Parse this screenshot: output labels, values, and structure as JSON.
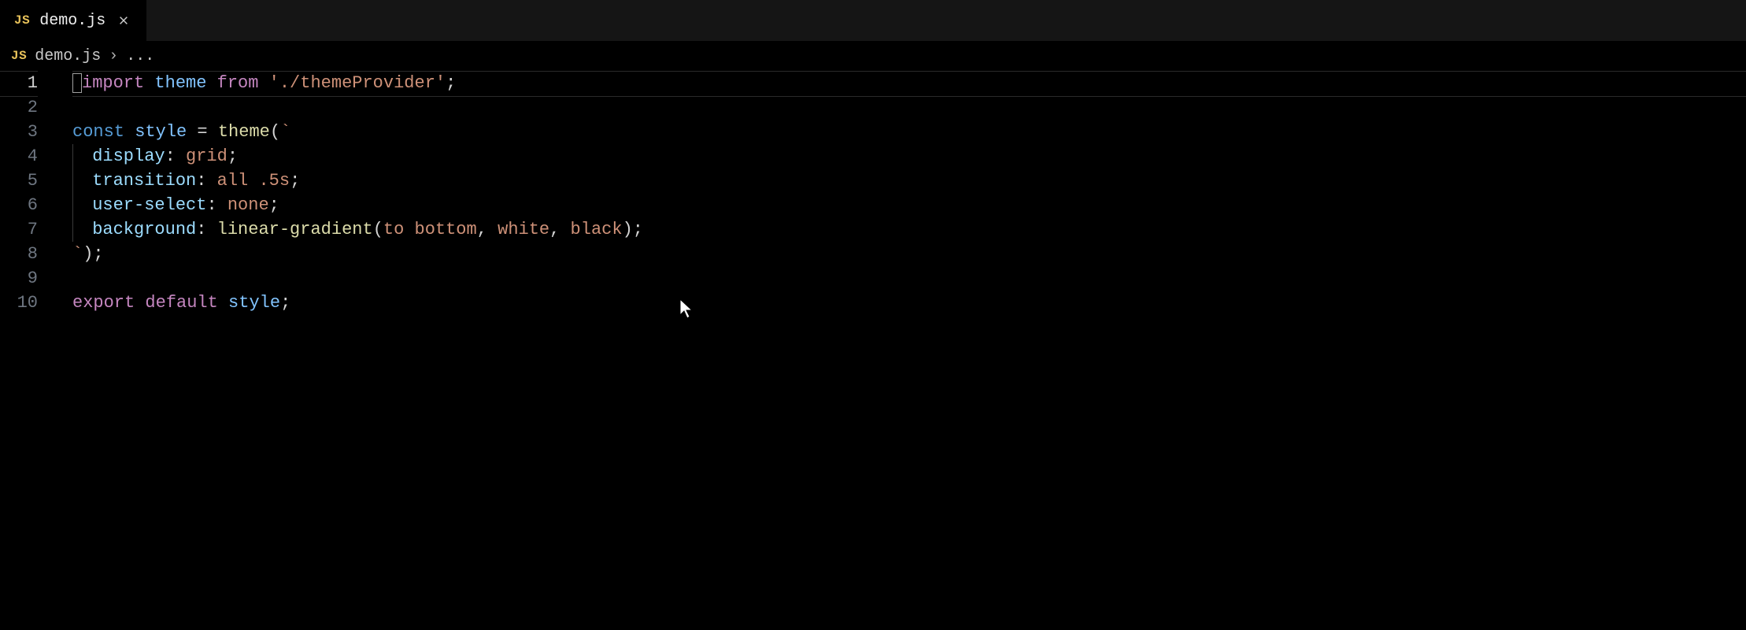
{
  "tab": {
    "badge": "JS",
    "filename": "demo.js"
  },
  "breadcrumb": {
    "badge": "JS",
    "filename": "demo.js",
    "chevron": "›",
    "extra": "..."
  },
  "lines": [
    {
      "n": "1",
      "tokens": [
        {
          "t": "import ",
          "c": "tk-keyword"
        },
        {
          "t": "theme",
          "c": "tk-var2"
        },
        {
          "t": " from ",
          "c": "tk-keyword"
        },
        {
          "t": "'./themeProvider'",
          "c": "tk-string"
        },
        {
          "t": ";",
          "c": "tk-plain"
        }
      ],
      "current": true
    },
    {
      "n": "2",
      "tokens": []
    },
    {
      "n": "3",
      "tokens": [
        {
          "t": "const ",
          "c": "tk-const"
        },
        {
          "t": "style",
          "c": "tk-var2"
        },
        {
          "t": " = ",
          "c": "tk-plain"
        },
        {
          "t": "theme",
          "c": "tk-func"
        },
        {
          "t": "(",
          "c": "tk-plain"
        },
        {
          "t": "`",
          "c": "tk-string"
        }
      ]
    },
    {
      "n": "4",
      "indent": true,
      "tokens": [
        {
          "t": " display",
          "c": "tk-prop"
        },
        {
          "t": ": ",
          "c": "tk-plain"
        },
        {
          "t": "grid",
          "c": "tk-string"
        },
        {
          "t": ";",
          "c": "tk-plain"
        }
      ]
    },
    {
      "n": "5",
      "indent": true,
      "tokens": [
        {
          "t": " transition",
          "c": "tk-prop"
        },
        {
          "t": ": ",
          "c": "tk-plain"
        },
        {
          "t": "all .5s",
          "c": "tk-string"
        },
        {
          "t": ";",
          "c": "tk-plain"
        }
      ]
    },
    {
      "n": "6",
      "indent": true,
      "tokens": [
        {
          "t": " user-select",
          "c": "tk-prop"
        },
        {
          "t": ": ",
          "c": "tk-plain"
        },
        {
          "t": "none",
          "c": "tk-string"
        },
        {
          "t": ";",
          "c": "tk-plain"
        }
      ]
    },
    {
      "n": "7",
      "indent": true,
      "tokens": [
        {
          "t": " background",
          "c": "tk-prop"
        },
        {
          "t": ": ",
          "c": "tk-plain"
        },
        {
          "t": "linear-gradient",
          "c": "tk-func"
        },
        {
          "t": "(",
          "c": "tk-plain"
        },
        {
          "t": "to bottom",
          "c": "tk-string"
        },
        {
          "t": ", ",
          "c": "tk-plain"
        },
        {
          "t": "white",
          "c": "tk-string"
        },
        {
          "t": ", ",
          "c": "tk-plain"
        },
        {
          "t": "black",
          "c": "tk-string"
        },
        {
          "t": ");",
          "c": "tk-plain"
        }
      ]
    },
    {
      "n": "8",
      "tokens": [
        {
          "t": "`",
          "c": "tk-string"
        },
        {
          "t": ");",
          "c": "tk-plain"
        }
      ]
    },
    {
      "n": "9",
      "tokens": []
    },
    {
      "n": "10",
      "tokens": [
        {
          "t": "export default ",
          "c": "tk-keyword"
        },
        {
          "t": "style",
          "c": "tk-var2"
        },
        {
          "t": ";",
          "c": "tk-plain"
        }
      ]
    }
  ]
}
